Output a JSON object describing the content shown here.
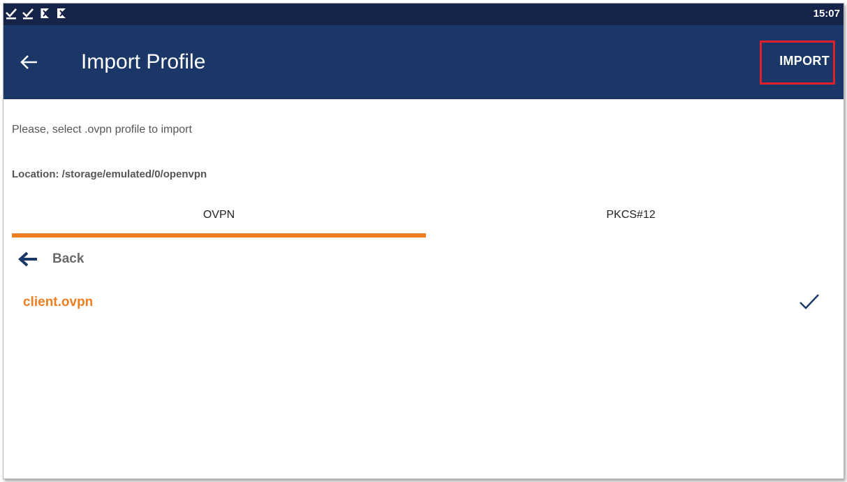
{
  "status_bar": {
    "icons": [
      "download-done-icon",
      "download-done-icon",
      "send-flag-icon",
      "send-flag-icon"
    ],
    "time": "15:07"
  },
  "app_bar": {
    "title": "Import Profile",
    "back_icon": "arrow-back-icon",
    "action_label": "IMPORT"
  },
  "content": {
    "instruction": "Please, select .ovpn profile to import",
    "location": "Location: /storage/emulated/0/openvpn"
  },
  "tabs": [
    {
      "label": "OVPN",
      "selected": true
    },
    {
      "label": "PKCS#12",
      "selected": false
    }
  ],
  "file_list": {
    "back_label": "Back",
    "items": [
      {
        "name": "client.ovpn",
        "selected": true
      }
    ]
  },
  "colors": {
    "status_bar": "#16244a",
    "app_bar": "#1b3768",
    "accent": "#ee7e1f",
    "highlight": "#e0202a",
    "check": "#1b3768"
  }
}
